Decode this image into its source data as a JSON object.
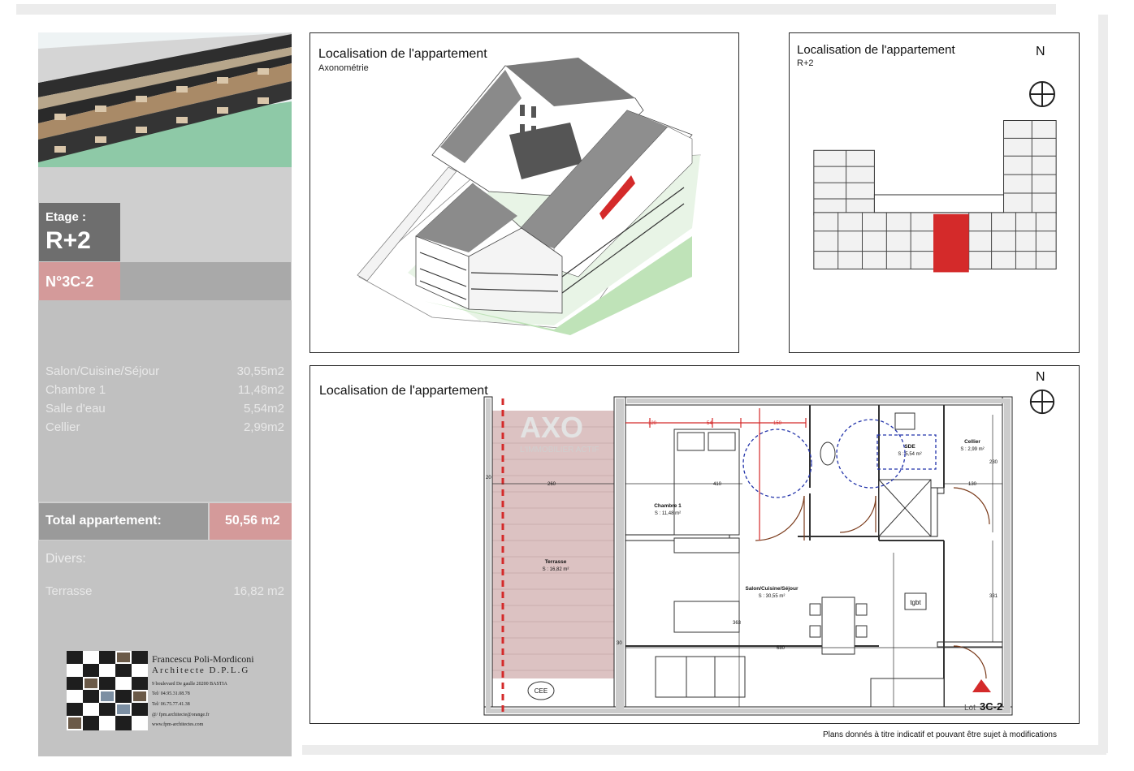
{
  "sidebar": {
    "etage_label": "Etage :",
    "etage_value": "R+2",
    "lot_number": "N°3C-2",
    "rooms": [
      {
        "name": "Salon/Cuisine/Séjour",
        "area": "30,55m2"
      },
      {
        "name": "Chambre 1",
        "area": "11,48m2"
      },
      {
        "name": "Salle d'eau",
        "area": "5,54m2"
      },
      {
        "name": "Cellier",
        "area": "2,99m2"
      }
    ],
    "total_label": "Total appartement:",
    "total_value": "50,56 m2",
    "divers_label": "Divers:",
    "terrasse_name": "Terrasse",
    "terrasse_area": "16,82 m2"
  },
  "architect": {
    "name": "Francescu Poli-Mordiconi",
    "title": "Architecte D.P.L.G",
    "address": "9 boulevard De gaulle 20200 BASTIA",
    "tel1": "Tel/ 04.95.31.08.78",
    "tel2": "Tel/ 06.75.77.41.38",
    "email": "@/ fpm.architecte@orange.fr",
    "web": "www.fpm-architectes.com"
  },
  "panels": {
    "axo": {
      "title": "Localisation de l'appartement",
      "subtitle": "Axonométrie"
    },
    "floor": {
      "title": "Localisation de l'appartement",
      "subtitle": "R+2",
      "north": "N"
    },
    "plan": {
      "title": "Localisation de l'appartement",
      "north": "N"
    }
  },
  "plan": {
    "terrasse_name": "Terrasse",
    "terrasse_area": "S : 16,82 m²",
    "chambre_name": "Chambre 1",
    "chambre_area": "S : 11,48 m²",
    "salon_name": "Salon/Cuisine/Séjour",
    "salon_area": "S : 30,55 m²",
    "sde_name": "SDE",
    "sde_area": "S : 5,54 m²",
    "cellier_name": "Cellier",
    "cellier_area": "S : 2,99 m²",
    "cee": "CEE",
    "tgbt": "tgbt",
    "lot_prefix": "Lot",
    "lot_code": "3C-2",
    "watermark": "AXO",
    "watermark_sub": "L'IMMOBILIER ACTIF",
    "dims": {
      "d120": "120",
      "d54": "54",
      "d150": "150",
      "d260": "260",
      "d410": "410",
      "d680": "680",
      "d130": "130",
      "d230": "230",
      "d331": "331",
      "d363": "363",
      "d20": "20",
      "d30": "30"
    }
  },
  "disclaimer": "Plans donnés à titre indicatif et pouvant être sujet à modifications",
  "colors": {
    "accent_red": "#d42a2a",
    "lot_pink": "#d49a9a",
    "terrace_fill": "#dcc2c2"
  }
}
